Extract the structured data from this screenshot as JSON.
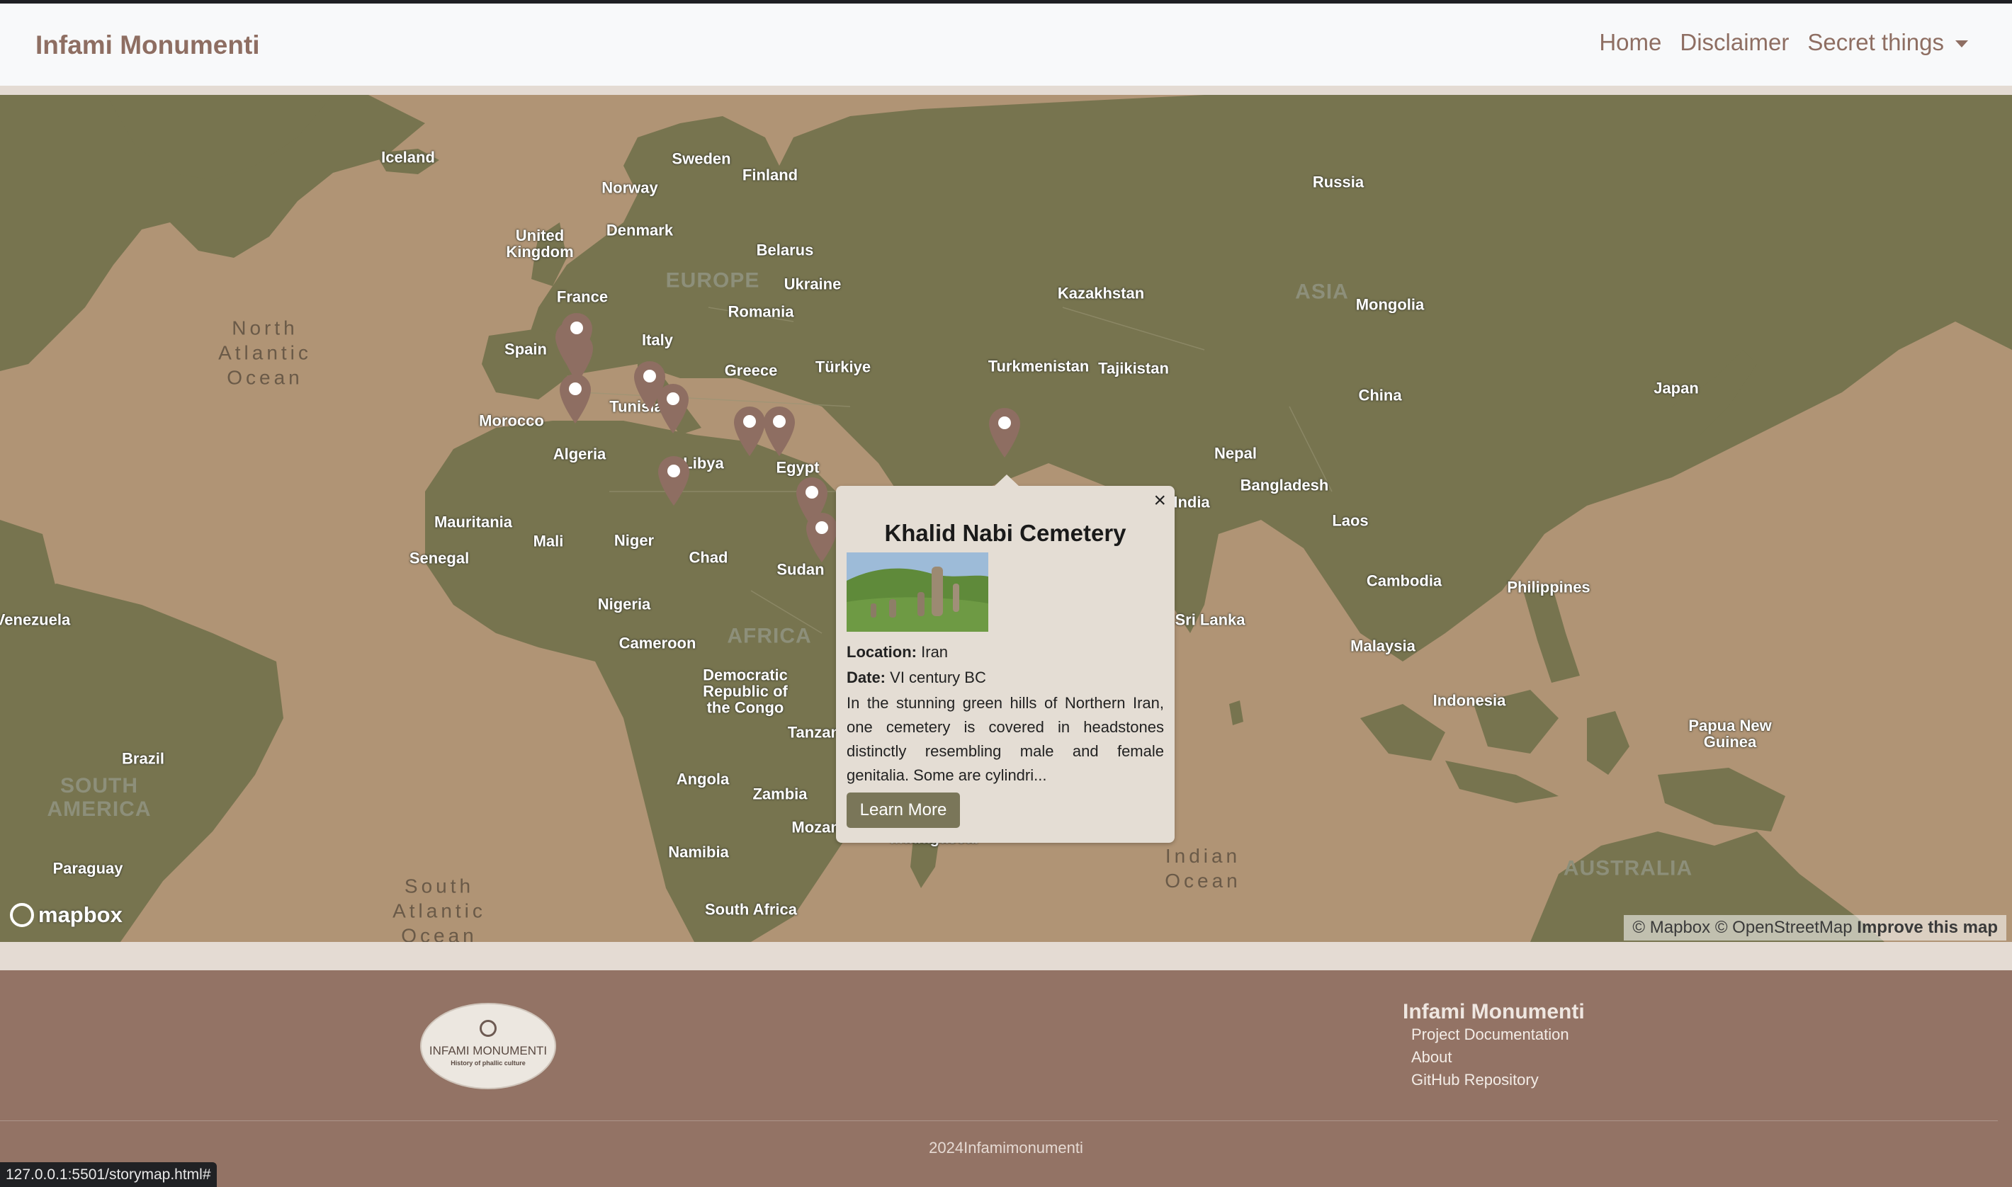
{
  "navbar": {
    "brand": "Infami Monumenti",
    "links": [
      "Home",
      "Disclaimer"
    ],
    "dropdown": "Secret things"
  },
  "map": {
    "countries": {
      "iceland": "Iceland",
      "sweden": "Sweden",
      "finland": "Finland",
      "norway": "Norway",
      "russia": "Russia",
      "uk": "United\nKingdom",
      "denmark": "Denmark",
      "belarus": "Belarus",
      "ukraine": "Ukraine",
      "france": "France",
      "romania": "Romania",
      "kazakhstan": "Kazakhstan",
      "mongolia": "Mongolia",
      "spain": "Spain",
      "italy": "Italy",
      "greece": "Greece",
      "turkiye": "Türkiye",
      "turkmenistan": "Turkmenistan",
      "tajikistan": "Tajikistan",
      "japan": "Japan",
      "china": "China",
      "tunisia": "Tunisia",
      "morocco": "Morocco",
      "algeria": "Algeria",
      "libya": "Libya",
      "egypt": "Egypt",
      "nepal": "Nepal",
      "bangladesh": "Bangladesh",
      "india": "India",
      "mauritania": "Mauritania",
      "mali": "Mali",
      "niger": "Niger",
      "chad": "Chad",
      "senegal": "Senegal",
      "sudan": "Sudan",
      "laos": "Laos",
      "cambodia": "Cambodia",
      "philippines": "Philippines",
      "venezuela": "Venezuela",
      "nigeria": "Nigeria",
      "srilanka": "Sri Lanka",
      "cameroon": "Cameroon",
      "malaysia": "Malaysia",
      "drc": "Democratic\nRepublic of\nthe Congo",
      "indonesia": "Indonesia",
      "tanzania": "Tanzania",
      "png": "Papua New\nGuinea",
      "brazil": "Brazil",
      "angola": "Angola",
      "zambia": "Zambia",
      "mozambique": "Mozambique",
      "madagascar": "Madagascar",
      "namibia": "Namibia",
      "paraguay": "Paraguay",
      "southafrica": "South Africa"
    },
    "oceans": {
      "north_atlantic": "North\nAtlantic\nOcean",
      "south_atlantic": "South\nAtlantic\nOcean",
      "indian": "Indian\nOcean"
    },
    "continents": {
      "europe": "EUROPE",
      "asia": "ASIA",
      "africa": "AFRICA",
      "south_america": "SOUTH\nAMERICA",
      "australia": "AUSTRALIA"
    },
    "logo_text": "mapbox",
    "attribution": "© Mapbox © OpenStreetMap",
    "improve": "Improve this map"
  },
  "popup": {
    "title": "Khalid Nabi Cemetery",
    "location_label": "Location:",
    "location": "Iran",
    "date_label": "Date:",
    "date": "VI century BC",
    "description": "In the stunning green hills of Northern Iran, one cemetery is covered in headstones distinctly resembling male and female genitalia. Some are cylindri...",
    "button": "Learn More",
    "close": "×"
  },
  "footer": {
    "logo_title": "INFAMI MONUMENTI",
    "logo_subtitle": "History of phallic culture",
    "title": "Infami Monumenti",
    "links": [
      "Project Documentation",
      "About",
      "GitHub Repository"
    ],
    "copyright": "2024Infamimonumenti"
  },
  "statusbar": "127.0.0.1:5501/storymap.html#",
  "colors": {
    "land": "#77744f",
    "water": "#b09475",
    "footer": "#937365",
    "brand": "#8e6e62"
  }
}
